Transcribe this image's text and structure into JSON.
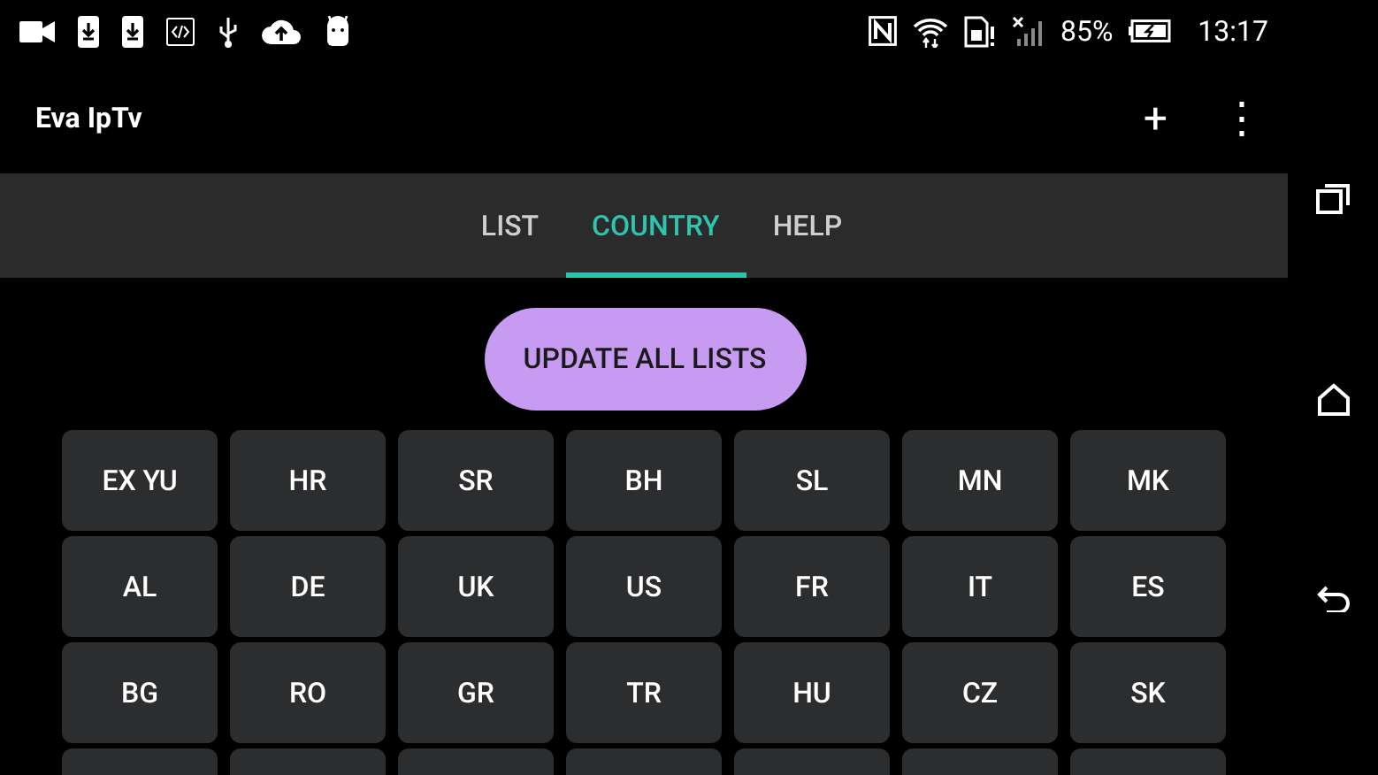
{
  "status_bar": {
    "battery": "85%",
    "time": "13:17"
  },
  "app_bar": {
    "title": "Eva IpTv",
    "actions": [
      "+",
      "⋮"
    ]
  },
  "tabs": [
    {
      "label": "LIST",
      "selected": false
    },
    {
      "label": "COUNTRY",
      "selected": true
    },
    {
      "label": "HELP",
      "selected": false
    }
  ],
  "update_button": "UPDATE ALL LISTS",
  "countries": [
    {
      "kind": "code",
      "label": "EX YU"
    },
    {
      "kind": "code",
      "label": "HR"
    },
    {
      "kind": "code",
      "label": "SR"
    },
    {
      "kind": "code",
      "label": "BH"
    },
    {
      "kind": "code",
      "label": "SL"
    },
    {
      "kind": "code",
      "label": "MN"
    },
    {
      "kind": "code",
      "label": "MK"
    },
    {
      "kind": "code",
      "label": "AL"
    },
    {
      "kind": "code",
      "label": "DE"
    },
    {
      "kind": "code",
      "label": "UK"
    },
    {
      "kind": "code",
      "label": "US"
    },
    {
      "kind": "code",
      "label": "FR"
    },
    {
      "kind": "code",
      "label": "IT"
    },
    {
      "kind": "code",
      "label": "ES"
    },
    {
      "kind": "code",
      "label": "BG"
    },
    {
      "kind": "code",
      "label": "RO"
    },
    {
      "kind": "code",
      "label": "GR"
    },
    {
      "kind": "code",
      "label": "TR"
    },
    {
      "kind": "code",
      "label": "HU"
    },
    {
      "kind": "code",
      "label": "CZ"
    },
    {
      "kind": "code",
      "label": "SK"
    },
    {
      "kind": "cut"
    },
    {
      "kind": "cut"
    },
    {
      "kind": "cut"
    },
    {
      "kind": "cut"
    },
    {
      "kind": "cut"
    },
    {
      "kind": "cut"
    },
    {
      "kind": "cut"
    }
  ]
}
